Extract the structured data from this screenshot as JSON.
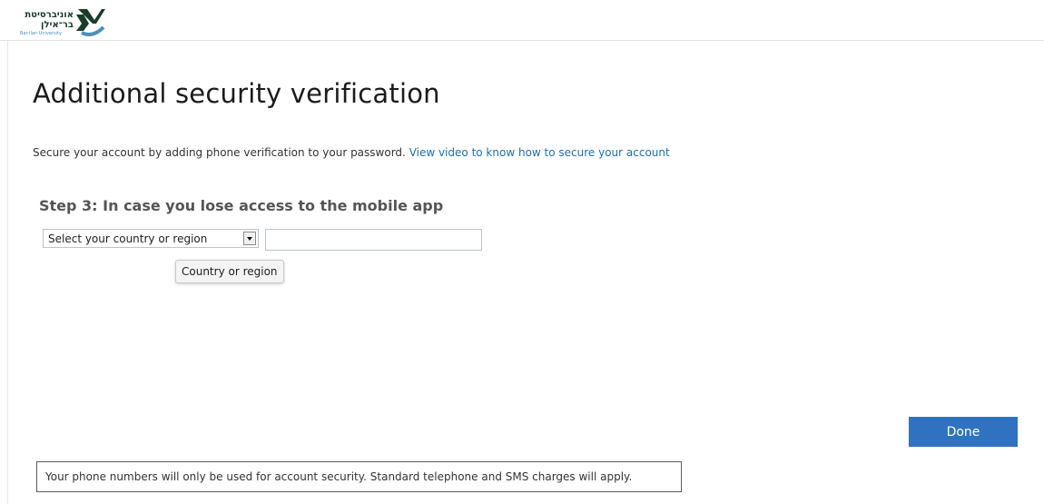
{
  "branding": {
    "logo_hebrew": "אוניברסיטת בר־אילן",
    "logo_english": "Bar-Ilan University",
    "logo_icon": "bar-ilan-logo-mark"
  },
  "main": {
    "title": "Additional security verification",
    "intro_text": "Secure your account by adding phone verification to your password.",
    "intro_link": "View video to know how to secure your account",
    "step_heading": "Step 3: In case you lose access to the mobile app",
    "country_select": {
      "selected": "Select your country or region",
      "tooltip": "Country or region"
    },
    "phone_input": {
      "value": "",
      "placeholder": ""
    },
    "done_label": "Done",
    "footer_note": "Your phone numbers will only be used for account security. Standard telephone and SMS charges will apply."
  },
  "colors": {
    "accent": "#2f73c0",
    "link": "#1b6fb5",
    "logo_green": "#1a3d26",
    "logo_blue": "#4a8fbf"
  }
}
